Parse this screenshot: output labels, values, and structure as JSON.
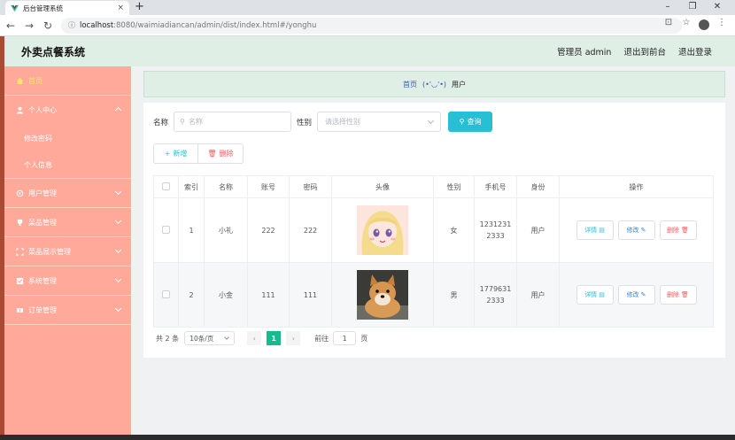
{
  "browser": {
    "tab_title": "后台管理系统",
    "url_host": "localhost",
    "url_rest": ":8080/waimiadiancan/admin/dist/index.html#/yonghu"
  },
  "header": {
    "title": "外卖点餐系统",
    "user": "管理员 admin",
    "to_front": "退出到前台",
    "logout": "退出登录"
  },
  "sidebar": {
    "home": "首页",
    "personal": "个人中心",
    "personal_sub": [
      "修改密码",
      "个人信息"
    ],
    "items": [
      "用户管理",
      "菜品管理",
      "菜品展示管理",
      "系统管理",
      "订单管理"
    ]
  },
  "breadcrumb": {
    "home": "首页",
    "face": "(•'◡'•)",
    "current": "用户"
  },
  "search": {
    "name_label": "名称",
    "name_placeholder": "名称",
    "gender_label": "性别",
    "gender_placeholder": "请选择性别",
    "query_button": "查询"
  },
  "actions": {
    "add": "新增",
    "delete": "删除"
  },
  "table": {
    "headers": [
      "索引",
      "名称",
      "账号",
      "密码",
      "头像",
      "性别",
      "手机号",
      "身份",
      "操作"
    ],
    "rows": [
      {
        "index": "1",
        "name": "小礼",
        "account": "222",
        "password": "222",
        "avatar": "anime-girl",
        "gender": "女",
        "phone": [
          "1231231",
          "2333"
        ],
        "role": "用户"
      },
      {
        "index": "2",
        "name": "小金",
        "account": "111",
        "password": "111",
        "avatar": "shiba-dog",
        "gender": "男",
        "phone": [
          "1779631",
          "2333"
        ],
        "role": "用户"
      }
    ],
    "op_detail": "详情",
    "op_edit": "修改",
    "op_delete": "删除"
  },
  "pager": {
    "total": "共 2 条",
    "page_size": "10条/页",
    "current_page": "1",
    "goto_label": "前往",
    "goto_value": "1",
    "goto_unit": "页"
  },
  "colors": {
    "sidebar": "#ffa99a",
    "header": "#dfefe6",
    "accent": "#27bfd3",
    "danger": "#f25b5b",
    "page_active": "#19b98e"
  }
}
